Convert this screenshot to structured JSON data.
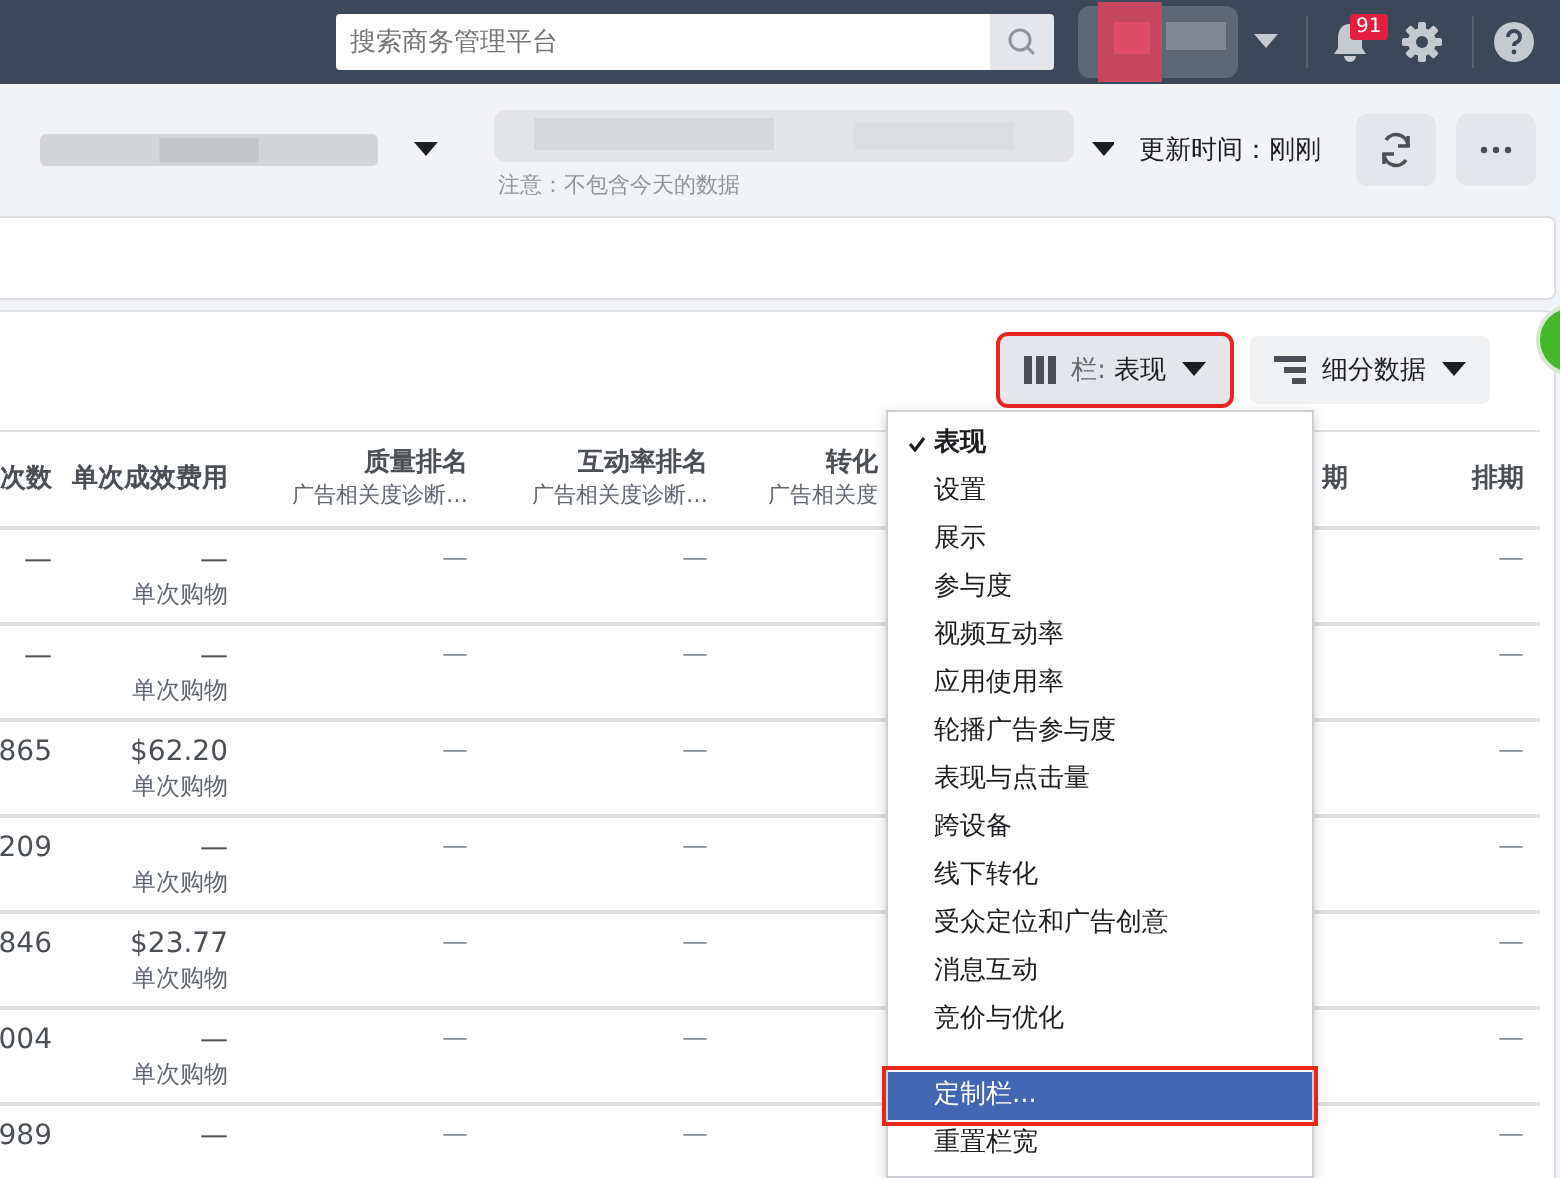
{
  "topbar": {
    "search": {
      "placeholder": "搜索商务管理平台"
    },
    "notifications": {
      "count": "91"
    }
  },
  "header": {
    "note": "注意：不包含今天的数据",
    "update_time": "更新时间：刚刚"
  },
  "toolbar": {
    "columns_button": {
      "prefix": "栏:",
      "value": "表现",
      "annotated": true
    },
    "breakdown_button": {
      "label": "细分数据"
    }
  },
  "table": {
    "columns": [
      {
        "title": "次数"
      },
      {
        "title": "单次成效费用"
      },
      {
        "title": "质量排名",
        "subtitle": "广告相关度诊断…"
      },
      {
        "title": "互动率排名",
        "subtitle": "广告相关度诊断…"
      },
      {
        "title": "转化",
        "subtitle": "广告相关度"
      },
      {
        "title": "期"
      },
      {
        "title": "排期"
      }
    ],
    "rows": [
      {
        "column_1": "—",
        "cost": "—",
        "cost_unit": "单次购物",
        "quality": "—",
        "engagement": "—",
        "schedule": "—"
      },
      {
        "column_1": "—",
        "cost": "—",
        "cost_unit": "单次购物",
        "quality": "—",
        "engagement": "—",
        "schedule": "—"
      },
      {
        "column_1": "865",
        "cost": "$62.20",
        "cost_unit": "单次购物",
        "quality": "—",
        "engagement": "—",
        "schedule": "—"
      },
      {
        "column_1": "209",
        "cost": "—",
        "cost_unit": "单次购物",
        "quality": "—",
        "engagement": "—",
        "schedule": "—"
      },
      {
        "column_1": "846",
        "cost": "$23.77",
        "cost_unit": "单次购物",
        "quality": "—",
        "engagement": "—",
        "schedule": "—"
      },
      {
        "column_1": "004",
        "cost": "—",
        "cost_unit": "单次购物",
        "quality": "—",
        "engagement": "—",
        "schedule": "—"
      },
      {
        "column_1": "989",
        "cost": "—",
        "quality": "—",
        "engagement": "—",
        "schedule": "—"
      }
    ]
  },
  "columns_menu": {
    "items": [
      {
        "label": "表现",
        "selected": true,
        "highlighted": false
      },
      {
        "label": "设置",
        "selected": false,
        "highlighted": false
      },
      {
        "label": "展示",
        "selected": false,
        "highlighted": false
      },
      {
        "label": "参与度",
        "selected": false,
        "highlighted": false
      },
      {
        "label": "视频互动率",
        "selected": false,
        "highlighted": false
      },
      {
        "label": "应用使用率",
        "selected": false,
        "highlighted": false
      },
      {
        "label": "轮播广告参与度",
        "selected": false,
        "highlighted": false
      },
      {
        "label": "表现与点击量",
        "selected": false,
        "highlighted": false
      },
      {
        "label": "跨设备",
        "selected": false,
        "highlighted": false
      },
      {
        "label": "线下转化",
        "selected": false,
        "highlighted": false
      },
      {
        "label": "受众定位和广告创意",
        "selected": false,
        "highlighted": false
      },
      {
        "label": "消息互动",
        "selected": false,
        "highlighted": false
      },
      {
        "label": "竞价与优化",
        "selected": false,
        "highlighted": false
      }
    ],
    "actions": [
      {
        "label": "定制栏...",
        "highlighted": true,
        "annotated": true
      },
      {
        "label": "重置栏宽",
        "highlighted": false,
        "annotated": false
      }
    ]
  }
}
